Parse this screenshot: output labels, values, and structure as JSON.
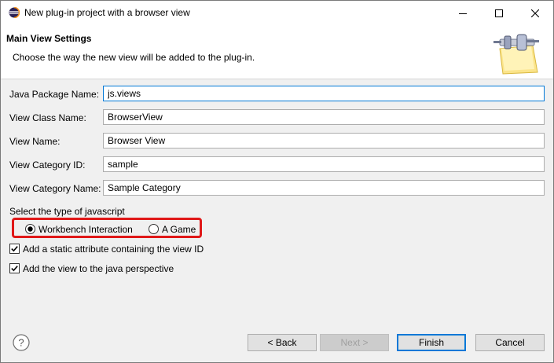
{
  "window": {
    "title": "New plug-in project with a browser view",
    "controls": {
      "minimize": "—",
      "maximize": "☐",
      "close": "✕"
    }
  },
  "header": {
    "title": "Main View Settings",
    "description": "Choose the way the new view will be added to the plug-in.",
    "icon": "wizard-plug-icon"
  },
  "form": {
    "package": {
      "label": "Java Package Name:",
      "value": "js.views"
    },
    "class": {
      "label": "View Class Name:",
      "value": "BrowserView"
    },
    "name": {
      "label": "View Name:",
      "value": "Browser View"
    },
    "category_id": {
      "label": "View Category ID:",
      "value": "sample"
    },
    "category_name": {
      "label": "View Category Name:",
      "value": "Sample Category"
    }
  },
  "js_type": {
    "label": "Select the type of javascript",
    "options": [
      {
        "label": "Workbench Interaction",
        "selected": true
      },
      {
        "label": "A Game",
        "selected": false
      }
    ],
    "highlight_color": "#e01818"
  },
  "checkboxes": [
    {
      "label": "Add a static attribute containing the view ID",
      "checked": true
    },
    {
      "label": "Add the view to the java perspective",
      "checked": true
    }
  ],
  "footer": {
    "help_icon": "question-mark-icon",
    "back": "< Back",
    "next": "Next >",
    "finish": "Finish",
    "cancel": "Cancel"
  },
  "colors": {
    "accent": "#0078d7",
    "header_bg": "#ffffff",
    "body_bg": "#f0f0f0"
  }
}
